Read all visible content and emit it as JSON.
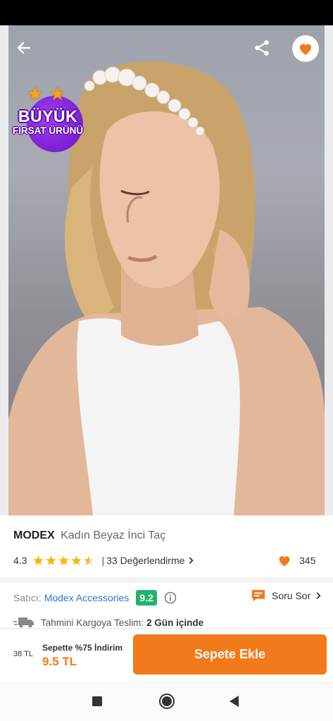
{
  "product": {
    "brand": "MODEX",
    "name": "Kadın Beyaz İnci Taç",
    "rating_value": "4.3",
    "rating_stars": 4.3,
    "review_count": "33 Değerlendirme",
    "likes": "345"
  },
  "badge": {
    "line1": "BÜYÜK",
    "line2": "FIRSAT ÜRÜNÜ"
  },
  "seller": {
    "label": "Satıcı:",
    "name": "Modex Accessories",
    "score": "9.2",
    "ask_label": "Soru Sor"
  },
  "shipping": {
    "label": "Tahmini Kargoya Teslim:",
    "days": "2 Gün içinde"
  },
  "purchase": {
    "old_price": "38 TL",
    "promo": "Sepette %75 İndirim",
    "new_price": "9.5 TL",
    "cart_button": "Sepete Ekle"
  },
  "colors": {
    "accent": "#f27a1a",
    "link": "#2a77c9",
    "score": "#1fb66a",
    "badge": "#7a1fd6"
  },
  "icons": [
    "back-arrow-icon",
    "share-icon",
    "heart-icon",
    "star-icon",
    "info-icon",
    "chat-icon",
    "truck-icon",
    "square-nav-icon",
    "home-circle-icon",
    "back-triangle-icon"
  ]
}
